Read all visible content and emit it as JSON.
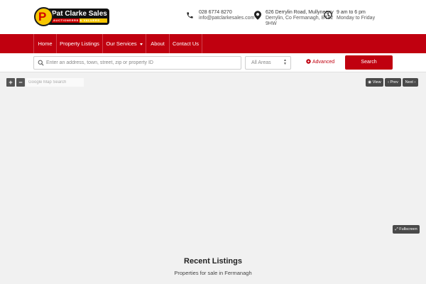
{
  "brand": {
    "logo_name": "Pat Clarke Sales",
    "logo_tagline": "AUCTIONEERS & VALUERS",
    "logo_letter": "P",
    "primary_color": "#c0000f",
    "accent_color": "#f7c600"
  },
  "contact": {
    "phone": "028 6774 8270",
    "email": "info@patclarkesales.com",
    "address_line1": "626 Derrylin Road, Mullyneeny",
    "address_line2": "Derrylin, Co Fermanagh, BT92",
    "address_line3": "9HW",
    "hours_line1": "9 am to 6 pm",
    "hours_line2": "Monday to Friday",
    "phone_icon": "phone-icon",
    "address_icon": "map-pin-icon",
    "hours_icon": "clock-icon"
  },
  "nav": {
    "items": [
      {
        "label": "Home"
      },
      {
        "label": "Property Listings"
      },
      {
        "label": "Our Services"
      },
      {
        "label": "About"
      },
      {
        "label": "Contact Us"
      }
    ]
  },
  "search": {
    "placeholder": "Enter an address, town, street, zip or property ID",
    "area_selected": "All Areas",
    "advanced_label": "Advanced",
    "button_label": "Search"
  },
  "map": {
    "zoom_in": "+",
    "zoom_out": "−",
    "search_placeholder": "Google Map Search",
    "view_label": "View",
    "prev_label": "Prev",
    "next_label": "Next",
    "fullscreen_label": "Fullscreen"
  },
  "listings": {
    "title": "Recent Listings",
    "subtitle": "Properties for sale in Fermanagh"
  }
}
